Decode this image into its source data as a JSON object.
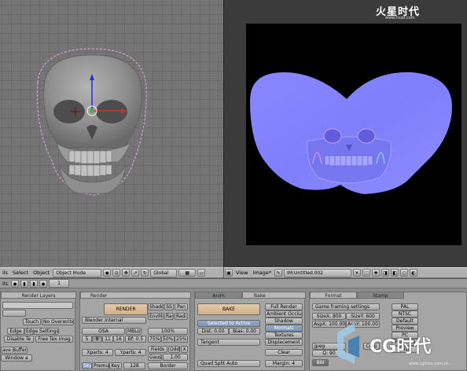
{
  "watermark_top": {
    "brand": "火星时代",
    "url": "www.hxsd.com"
  },
  "watermark_bottom": {
    "brand": "CG时代",
    "url": "www.cgtime.com.cn"
  },
  "header_3d": {
    "view_label": "ils",
    "select_label": "Select",
    "object_label": "Object",
    "mode_value": "Object Mode",
    "orientation_value": "Global"
  },
  "header_image": {
    "view_label": "View",
    "image_label": "Image*",
    "image_name": "IM:Untitled.002"
  },
  "ruler": {
    "page_field": "1"
  },
  "render_layers_panel": {
    "tab_label": "Render Layers",
    "touch_label": "Touch",
    "no_overwrite_label": "No Overwrite",
    "edge_label": "Edge",
    "edge_settings_label": "Edge Settings",
    "disable_tex_label": "Disable Te",
    "free_tex_label": "Free Tex Imag",
    "save_buffers_label": "ave Buffers",
    "window_label": "Window a"
  },
  "render_panel": {
    "tab_label": "Render",
    "render_button": "RENDER",
    "shado_label": "Shado",
    "ss_label": "SS",
    "pan_label": "Pan",
    "engine_value": "Blender Internal",
    "envma_label": "EnvMa",
    "ray_label": "Ray",
    "radi_label": "Radi",
    "osa_label": "OSA",
    "mblur_label": "MBLUR",
    "percent_100": "100%",
    "osa_options": [
      "5",
      "8",
      "11",
      "16"
    ],
    "bf_value": "Bf: 0.5",
    "percent_options": [
      "75%",
      "50%",
      "25%"
    ],
    "xparts_value": "Xparts: 4",
    "yparts_value": "Yparts: 4",
    "fields_label": "Fields",
    "odd_label": "Odd",
    "x_label": "X",
    "gauss_value": "Gaus",
    "gauss_number": "1.00",
    "sky_label": "Sky",
    "premul_label": "Premul",
    "key_label": "Key",
    "size_value": "128",
    "border_label": "Border"
  },
  "bake_panel": {
    "anim_tab": "Anim",
    "bake_tab": "Bake",
    "bake_button": "BAKE",
    "selected_to_active": "Selected to Active",
    "dist_value": "Dist: 0.00",
    "bias_value": "Bias: 0.00",
    "space_value": "Tangent",
    "clear_button": "Clear",
    "split_value": "Quad Split Auto",
    "margin_value": "Margin: 4",
    "modes": [
      "Full Render",
      "Ambient Occlusi",
      "Shadow",
      "Normals",
      "Textures",
      "Displacement"
    ],
    "active_mode": "Normals"
  },
  "format_panel": {
    "format_tab": "Format",
    "stamp_tab": "Stamp",
    "preset_value": "Game framing settings",
    "sizex_value": "SizeX: 800",
    "sizey_value": "SizeY: 600",
    "aspx_value": "AspX: 100.00",
    "aspy_value": "AspY: 100.00",
    "presets": [
      "PAL",
      "NTSC",
      "Default",
      "Preview",
      "PC",
      "PAL 16:9",
      "FULL"
    ],
    "jpeg_label": "Jpeg",
    "crop_label": "Crop",
    "quality_value": "Q: 90",
    "bw_label": "BW"
  },
  "colors": {
    "normal_map_base": "#8080ff",
    "canvas_bg": "#000000",
    "active_button": "#7d93b8",
    "render_button": "#d2b08a"
  }
}
